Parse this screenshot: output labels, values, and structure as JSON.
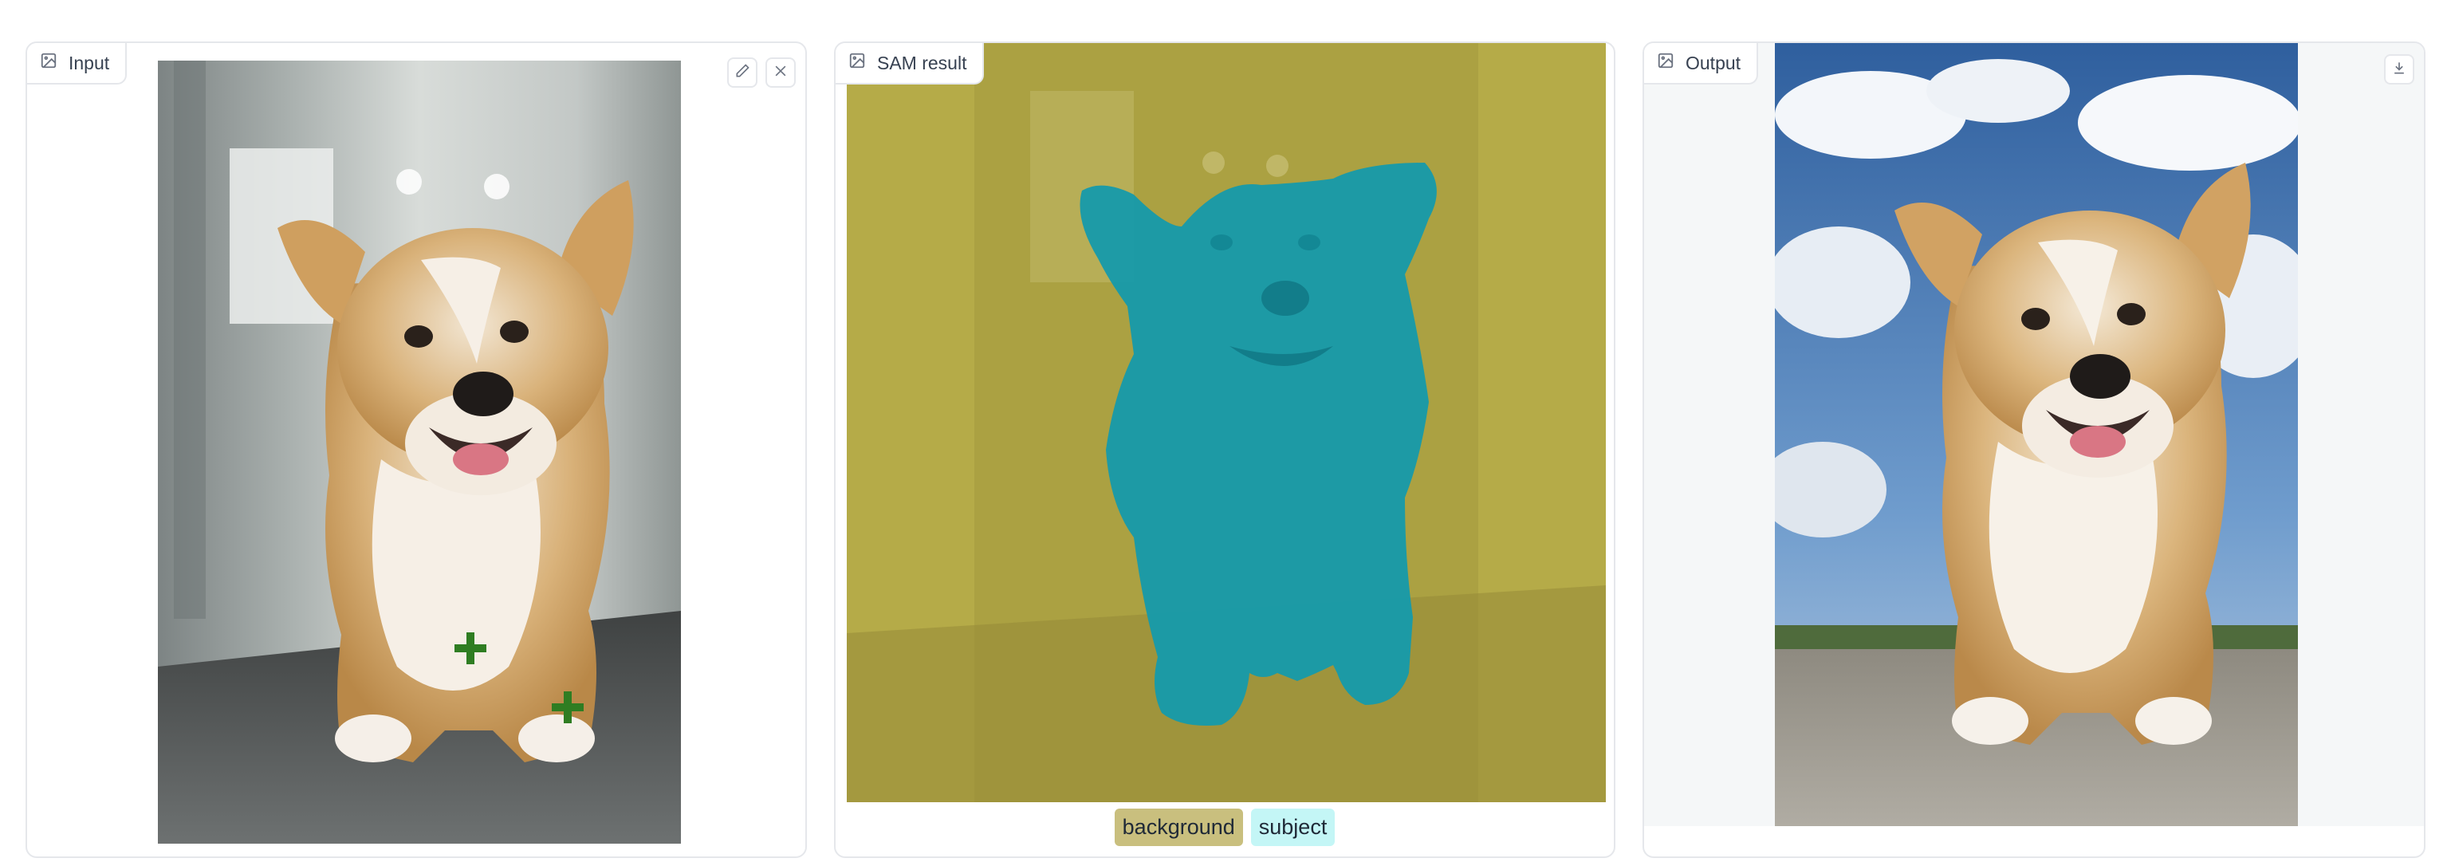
{
  "panels": {
    "input": {
      "label": "Input",
      "icon": "image-icon",
      "actions": [
        "edit-icon",
        "close-icon"
      ]
    },
    "sam": {
      "label": "SAM result",
      "icon": "image-icon"
    },
    "output": {
      "label": "Output",
      "icon": "image-icon",
      "actions": [
        "download-icon"
      ]
    }
  },
  "legend": {
    "items": [
      {
        "label": "background",
        "color": "#c9bf7e"
      },
      {
        "label": "subject",
        "color": "#c4f6f6"
      }
    ]
  },
  "colors": {
    "mask_background": "#b5ab48",
    "mask_subject": "#159aab",
    "point_marker": "#2f7d22"
  },
  "points": [
    {
      "marker": "plus",
      "label": ""
    },
    {
      "marker": "plus",
      "label": ""
    }
  ]
}
